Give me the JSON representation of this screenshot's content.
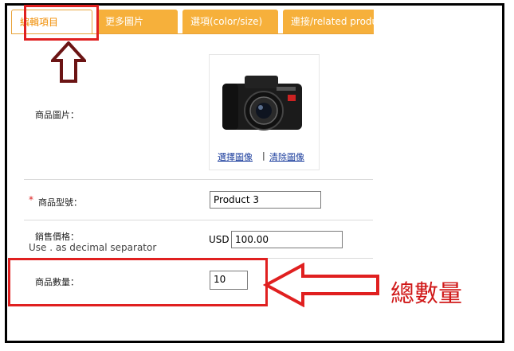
{
  "tabs": [
    {
      "label": "編輯項目",
      "active": true
    },
    {
      "label": "更多圖片",
      "active": false
    },
    {
      "label": "選項(color/size)",
      "active": false
    },
    {
      "label": "連接/related produc",
      "active": false
    }
  ],
  "fields": {
    "image": {
      "label": "商品圖片：",
      "select_link": "選擇圖像",
      "separator": "|",
      "clear_link": "清除圖像"
    },
    "model": {
      "required_mark": "*",
      "label": "商品型號：",
      "value": "Product 3"
    },
    "price": {
      "label": "銷售價格：",
      "note": "Use . as decimal separator",
      "currency": "USD",
      "value": "100.00"
    },
    "quantity": {
      "label": "商品數量：",
      "value": "10"
    }
  },
  "annotation": {
    "text": "總數量"
  },
  "colors": {
    "tab_orange": "#f6b03b",
    "highlight_red": "#e02020",
    "annotation_red": "#d01818",
    "arrow_dark_red": "#6b1414"
  }
}
